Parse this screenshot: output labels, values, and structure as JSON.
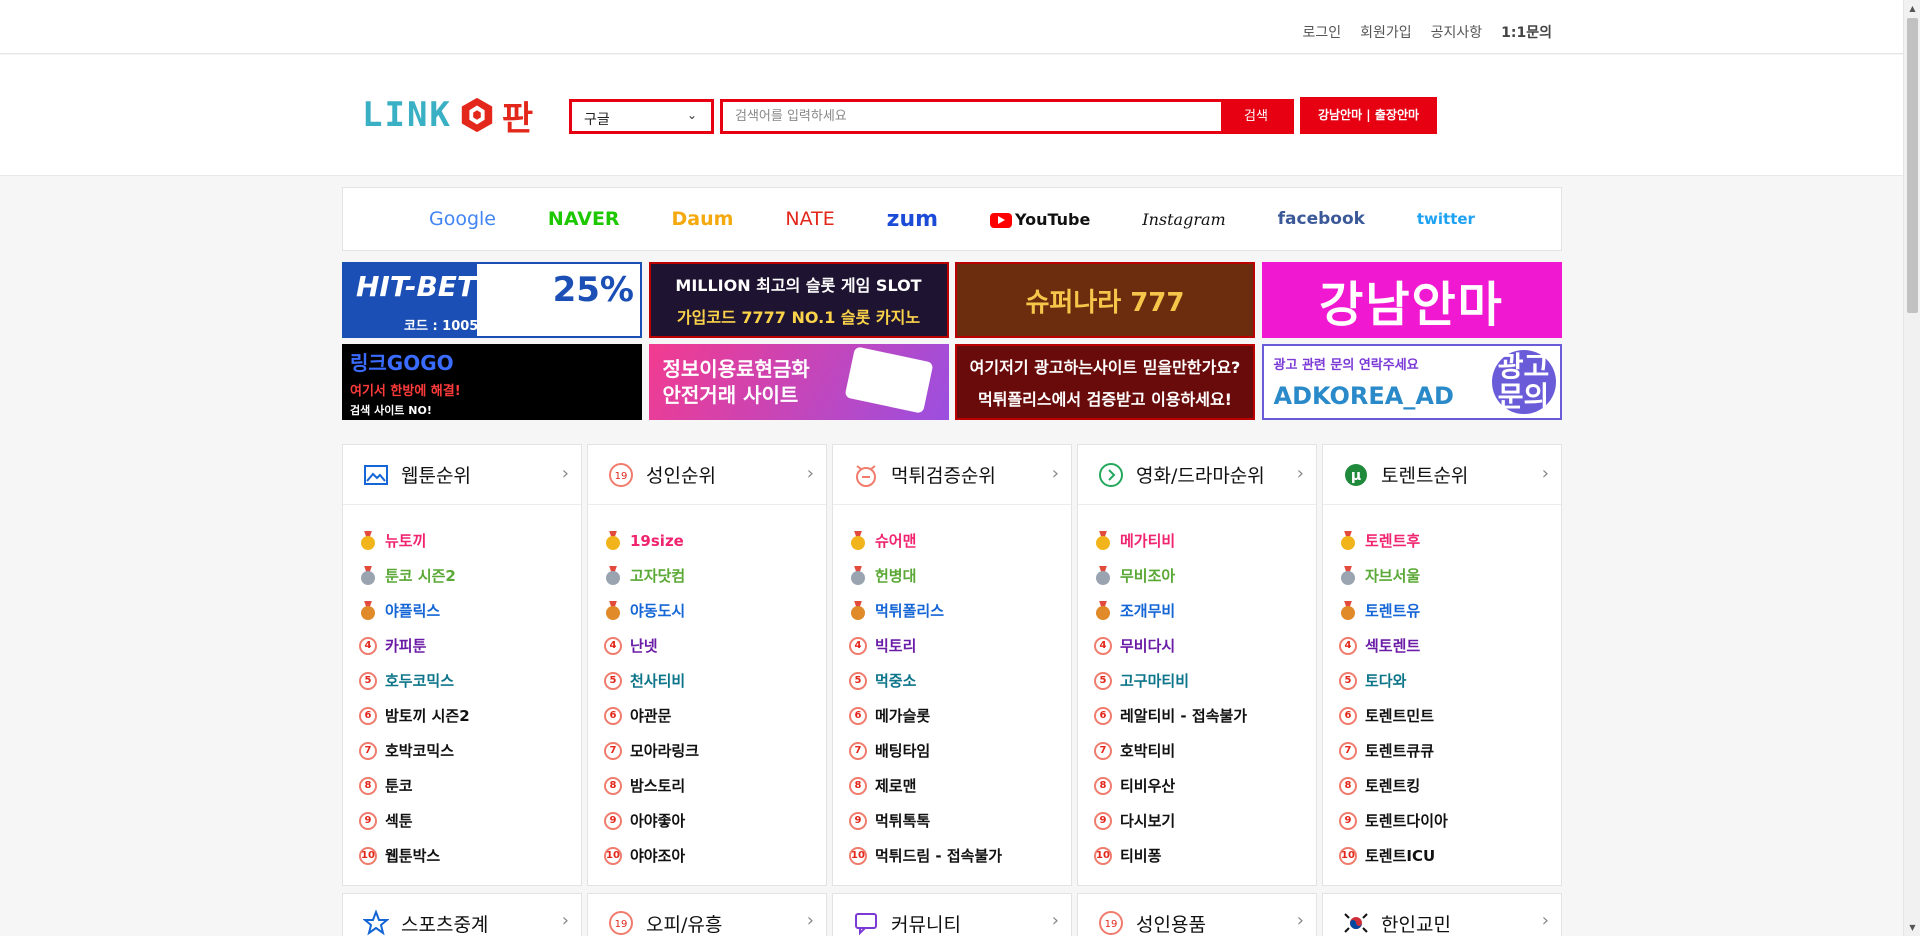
{
  "top_links": [
    "로그인",
    "회원가입",
    "공지사항",
    "1:1문의"
  ],
  "logo": {
    "text": "LINK",
    "suffix": "판"
  },
  "search": {
    "engine_selected": "구글",
    "placeholder": "검색어를 입력하세요",
    "button": "검색"
  },
  "promo_button": "강남안마 | 출장안마",
  "engines": [
    {
      "name": "Google",
      "color": "#4285f4"
    },
    {
      "name": "NAVER",
      "color": "#1ec800"
    },
    {
      "name": "Daum",
      "color": "#f4a90e"
    },
    {
      "name": "NATE",
      "color": "#e3271b"
    },
    {
      "name": "zum",
      "color": "#1c4bd8"
    },
    {
      "name": "YouTube",
      "color": "#111111"
    },
    {
      "name": "Instagram",
      "color": "#111111"
    },
    {
      "name": "facebook",
      "color": "#3b5998"
    },
    {
      "name": "twitter",
      "color": "#1da1f2"
    }
  ],
  "banners": {
    "b1": {
      "title": "HIT-BET",
      "promo": "25%",
      "code": "코드 : 1005"
    },
    "b2": {
      "line1": "MILLION 최고의 슬롯 게임 SLOT",
      "line2": "가입코드 7777 NO.1 슬롯 카지노"
    },
    "b3": {
      "title": "슈퍼나라 777"
    },
    "b4": {
      "title": "강남안마"
    },
    "b5": {
      "line1": "링크GOGO",
      "line2": "여기서 한방에 해결!",
      "line3": "검색 사이트 NO!"
    },
    "b6": {
      "line1": "정보이용료현금화",
      "line2": "안전거래 사이트"
    },
    "b7": {
      "line1": "여기저기 광고하는사이트 믿을만한가요?",
      "line2": "먹튀폴리스에서 검증받고 이용하세요!"
    },
    "b8": {
      "line1": "광고 관련 문의 연락주세요",
      "line2": "ADKOREA_AD",
      "badge": "광고 문의"
    }
  },
  "panels": [
    {
      "title": "웹툰순위",
      "icon": "image-icon",
      "items": [
        {
          "label": "뉴토끼",
          "color": "c-pink"
        },
        {
          "label": "툰코 시즌2",
          "color": "c-green"
        },
        {
          "label": "야플릭스",
          "color": "c-blue"
        },
        {
          "label": "카피툰",
          "color": "c-purple"
        },
        {
          "label": "호두코믹스",
          "color": "c-teal"
        },
        {
          "label": "밤토끼 시즌2",
          "color": "c-dark"
        },
        {
          "label": "호박코믹스",
          "color": "c-dark"
        },
        {
          "label": "툰코",
          "color": "c-dark"
        },
        {
          "label": "섹툰",
          "color": "c-dark"
        },
        {
          "label": "웹툰박스",
          "color": "c-dark"
        }
      ]
    },
    {
      "title": "성인순위",
      "icon": "nineteen-icon",
      "items": [
        {
          "label": "19size",
          "color": "c-pink"
        },
        {
          "label": "고자닷컴",
          "color": "c-green"
        },
        {
          "label": "야동도시",
          "color": "c-blue"
        },
        {
          "label": "난넷",
          "color": "c-purple"
        },
        {
          "label": "천사티비",
          "color": "c-teal"
        },
        {
          "label": "야관문",
          "color": "c-dark"
        },
        {
          "label": "모아라링크",
          "color": "c-dark"
        },
        {
          "label": "밤스토리",
          "color": "c-dark"
        },
        {
          "label": "아야좋아",
          "color": "c-dark"
        },
        {
          "label": "야야조아",
          "color": "c-dark"
        }
      ]
    },
    {
      "title": "먹튀검증순위",
      "icon": "alarm-icon",
      "items": [
        {
          "label": "슈어맨",
          "color": "c-pink"
        },
        {
          "label": "헌병대",
          "color": "c-green"
        },
        {
          "label": "먹튀폴리스",
          "color": "c-blue"
        },
        {
          "label": "빅토리",
          "color": "c-purple"
        },
        {
          "label": "먹중소",
          "color": "c-teal"
        },
        {
          "label": "메가슬롯",
          "color": "c-dark"
        },
        {
          "label": "배팅타임",
          "color": "c-dark"
        },
        {
          "label": "제로맨",
          "color": "c-dark"
        },
        {
          "label": "먹튀톡톡",
          "color": "c-dark"
        },
        {
          "label": "먹튀드림 - 접속불가",
          "color": "c-dark"
        }
      ]
    },
    {
      "title": "영화/드라마순위",
      "icon": "play-circle-icon",
      "items": [
        {
          "label": "메가티비",
          "color": "c-pink"
        },
        {
          "label": "무비조아",
          "color": "c-green"
        },
        {
          "label": "조개무비",
          "color": "c-blue"
        },
        {
          "label": "무비다시",
          "color": "c-purple"
        },
        {
          "label": "고구마티비",
          "color": "c-teal"
        },
        {
          "label": "레알티비 - 접속불가",
          "color": "c-dark"
        },
        {
          "label": "호박티비",
          "color": "c-dark"
        },
        {
          "label": "티비우산",
          "color": "c-dark"
        },
        {
          "label": "다시보기",
          "color": "c-dark"
        },
        {
          "label": "티비퐁",
          "color": "c-dark"
        }
      ]
    },
    {
      "title": "토렌트순위",
      "icon": "torrent-icon",
      "items": [
        {
          "label": "토렌트후",
          "color": "c-pink"
        },
        {
          "label": "자브서울",
          "color": "c-green"
        },
        {
          "label": "토렌트유",
          "color": "c-blue"
        },
        {
          "label": "섹토렌트",
          "color": "c-purple"
        },
        {
          "label": "토다와",
          "color": "c-teal"
        },
        {
          "label": "토렌트민트",
          "color": "c-dark"
        },
        {
          "label": "토렌트큐큐",
          "color": "c-dark"
        },
        {
          "label": "토렌트킹",
          "color": "c-dark"
        },
        {
          "label": "토렌트다이아",
          "color": "c-dark"
        },
        {
          "label": "토렌트ICU",
          "color": "c-dark"
        }
      ]
    }
  ],
  "panels_row2": [
    {
      "title": "스포츠중계",
      "icon": "star-icon"
    },
    {
      "title": "오피/유흥",
      "icon": "nineteen-icon"
    },
    {
      "title": "커뮤니티",
      "icon": "chat-icon"
    },
    {
      "title": "성인용품",
      "icon": "nineteen-icon"
    },
    {
      "title": "한인교민",
      "icon": "korea-flag-icon"
    }
  ]
}
